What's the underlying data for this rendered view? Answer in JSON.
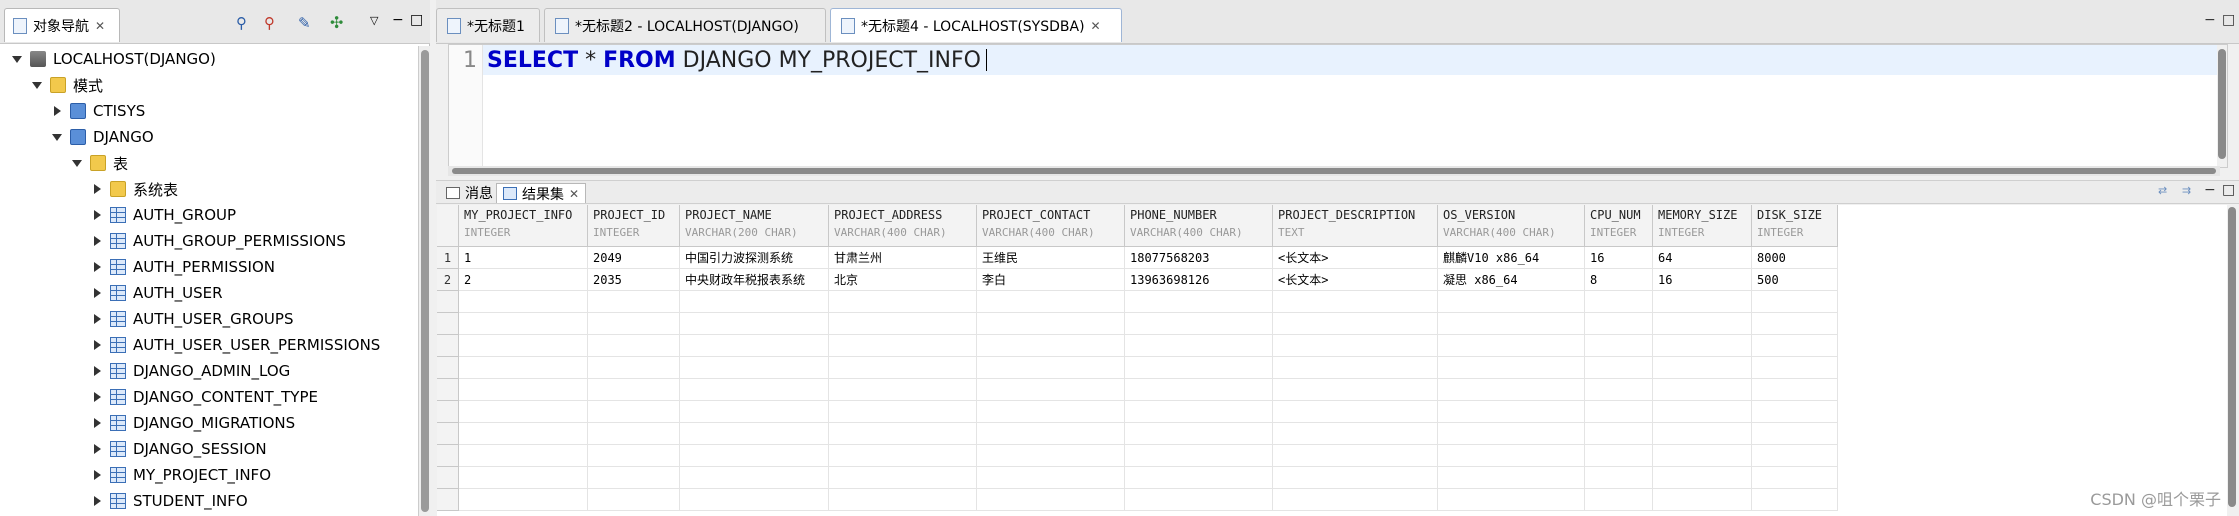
{
  "nav": {
    "tab_label": "对象导航",
    "tree": [
      {
        "label": "LOCALHOST(DJANGO)",
        "level": 0,
        "state": "open",
        "icon": "database"
      },
      {
        "label": "模式",
        "level": 1,
        "state": "open",
        "icon": "folder"
      },
      {
        "label": "CTISYS",
        "level": 2,
        "state": "closed",
        "icon": "schema"
      },
      {
        "label": "DJANGO",
        "level": 2,
        "state": "open",
        "icon": "schema"
      },
      {
        "label": "表",
        "level": 3,
        "state": "open",
        "icon": "folder"
      },
      {
        "label": "系统表",
        "level": 4,
        "state": "closed",
        "icon": "folder"
      },
      {
        "label": "AUTH_GROUP",
        "level": 4,
        "state": "closed",
        "icon": "table"
      },
      {
        "label": "AUTH_GROUP_PERMISSIONS",
        "level": 4,
        "state": "closed",
        "icon": "table"
      },
      {
        "label": "AUTH_PERMISSION",
        "level": 4,
        "state": "closed",
        "icon": "table"
      },
      {
        "label": "AUTH_USER",
        "level": 4,
        "state": "closed",
        "icon": "table"
      },
      {
        "label": "AUTH_USER_GROUPS",
        "level": 4,
        "state": "closed",
        "icon": "table"
      },
      {
        "label": "AUTH_USER_USER_PERMISSIONS",
        "level": 4,
        "state": "closed",
        "icon": "table"
      },
      {
        "label": "DJANGO_ADMIN_LOG",
        "level": 4,
        "state": "closed",
        "icon": "table"
      },
      {
        "label": "DJANGO_CONTENT_TYPE",
        "level": 4,
        "state": "closed",
        "icon": "table"
      },
      {
        "label": "DJANGO_MIGRATIONS",
        "level": 4,
        "state": "closed",
        "icon": "table"
      },
      {
        "label": "DJANGO_SESSION",
        "level": 4,
        "state": "closed",
        "icon": "table"
      },
      {
        "label": "MY_PROJECT_INFO",
        "level": 4,
        "state": "closed",
        "icon": "table"
      },
      {
        "label": "STUDENT_INFO",
        "level": 4,
        "state": "closed",
        "icon": "table"
      }
    ]
  },
  "editor_tabs": [
    {
      "label": "*无标题1"
    },
    {
      "label": "*无标题2 - LOCALHOST(DJANGO)"
    },
    {
      "label": "*无标题4 - LOCALHOST(SYSDBA)"
    }
  ],
  "editor": {
    "line_number": "1",
    "kw_select": "SELECT",
    "star": "*",
    "kw_from": "FROM",
    "rest": "DJANGO MY_PROJECT_INFO"
  },
  "result_tabs": {
    "messages": "消息",
    "resultset": "结果集"
  },
  "grid": {
    "columns": [
      {
        "name": "MY_PROJECT_INFO",
        "type": "INTEGER"
      },
      {
        "name": "PROJECT_ID",
        "type": "INTEGER"
      },
      {
        "name": "PROJECT_NAME",
        "type": "VARCHAR(200 CHAR)"
      },
      {
        "name": "PROJECT_ADDRESS",
        "type": "VARCHAR(400 CHAR)"
      },
      {
        "name": "PROJECT_CONTACT",
        "type": "VARCHAR(400 CHAR)"
      },
      {
        "name": "PHONE_NUMBER",
        "type": "VARCHAR(400 CHAR)"
      },
      {
        "name": "PROJECT_DESCRIPTION",
        "type": "TEXT"
      },
      {
        "name": "OS_VERSION",
        "type": "VARCHAR(400 CHAR)"
      },
      {
        "name": "CPU_NUM",
        "type": "INTEGER"
      },
      {
        "name": "MEMORY_SIZE",
        "type": "INTEGER"
      },
      {
        "name": "DISK_SIZE",
        "type": "INTEGER"
      }
    ],
    "rows": [
      {
        "num": "1",
        "cells": [
          "1",
          "2049",
          "中国引力波探测系统",
          "甘肃兰州",
          "王维民",
          "18077568203",
          "<长文本>",
          "麒麟V10 x86_64",
          "16",
          "64",
          "8000"
        ]
      },
      {
        "num": "2",
        "cells": [
          "2",
          "2035",
          "中央财政年税报表系统",
          "北京",
          "李白",
          "13963698126",
          "<长文本>",
          "凝思 x86_64",
          "8",
          "16",
          "500"
        ]
      }
    ]
  },
  "watermark": "CSDN @咀个栗子"
}
